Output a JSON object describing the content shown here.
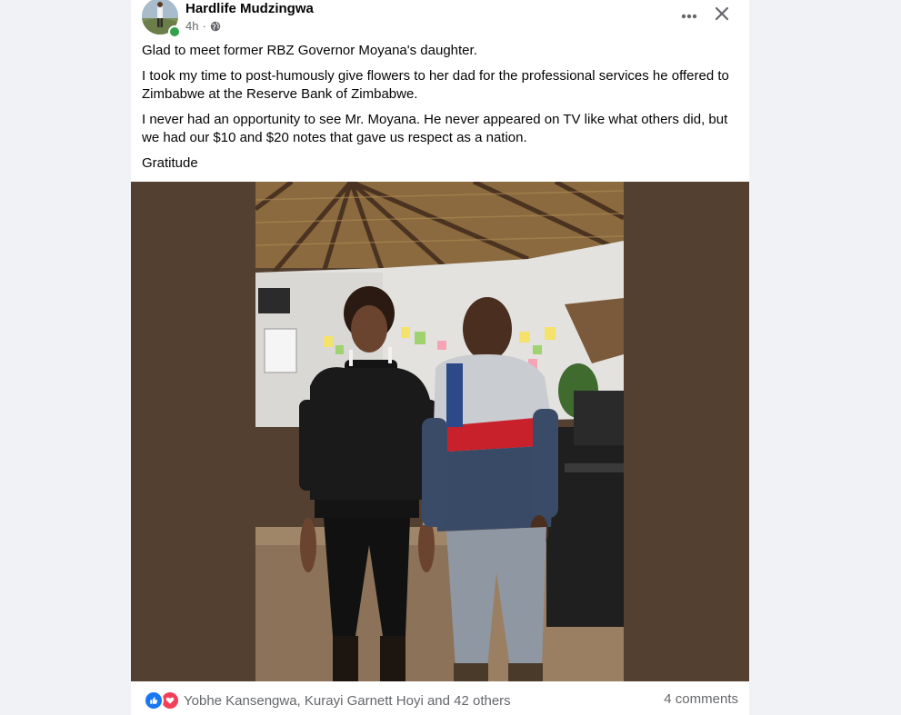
{
  "post": {
    "author": "Hardlife Mudzingwa",
    "time": "4h",
    "separator": "·",
    "privacy_icon": "globe-icon",
    "paragraphs": [
      "Glad to meet former RBZ Governor Moyana's daughter.",
      "I took my time to post-humously give flowers to her dad for the professional services he offered to Zimbabwe at the Reserve Bank of Zimbabwe.",
      "I never had an opportunity to see Mr. Moyana. He never appeared on TV like what others did, but we had our $10 and $20 notes that gave us respect as a nation.",
      "Gratitude"
    ]
  },
  "actions": {
    "more_icon": "more-options-icon",
    "close_icon": "close-icon"
  },
  "footer": {
    "reaction_names": "Yobhe Kansengwa, Kurayi Garnett Hoyi and 42 others",
    "comments": "4 comments",
    "reaction_icons": [
      "like-icon",
      "love-icon"
    ]
  },
  "colors": {
    "page_bg": "#f0f2f5",
    "card_bg": "#ffffff",
    "photo_frame_bg": "#534030",
    "secondary_text": "#65676b",
    "like_blue": "#1877f2",
    "love_red": "#f33e58",
    "online_green": "#31a24c"
  }
}
